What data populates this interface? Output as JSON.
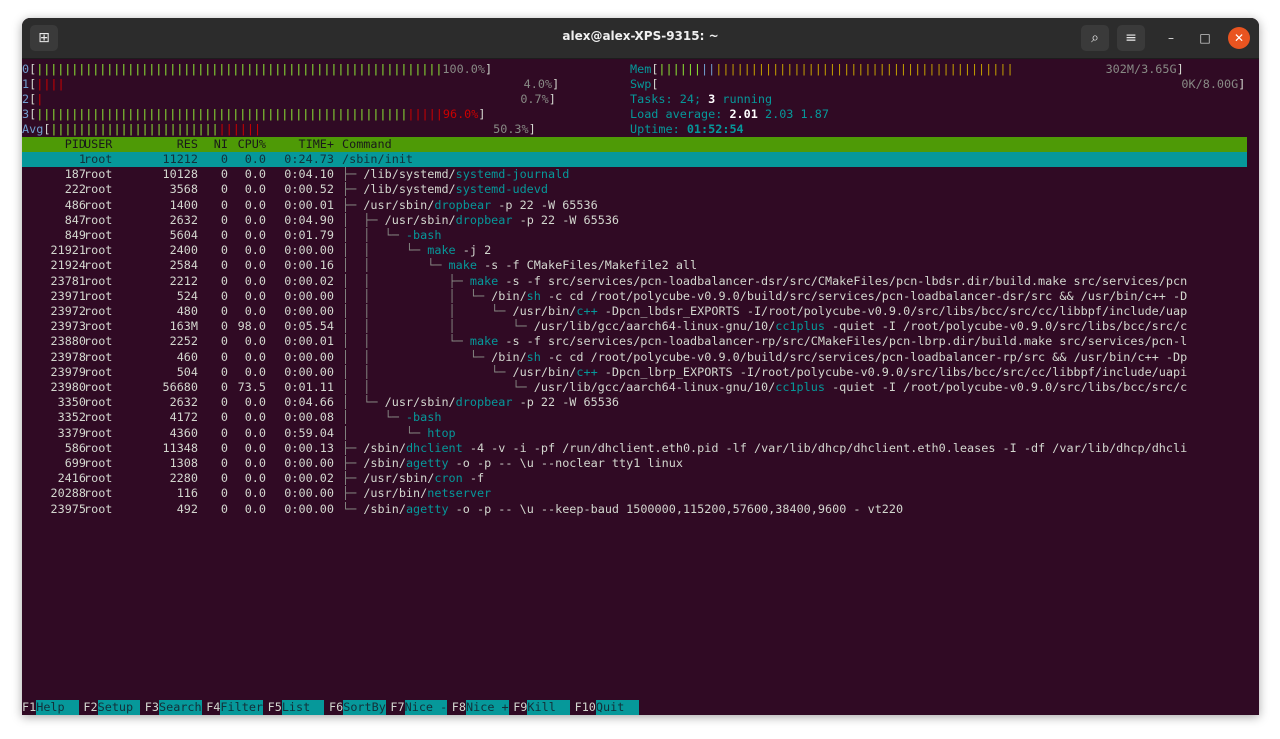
{
  "window": {
    "title": "alex@alex-XPS-9315: ~",
    "icons": {
      "new_tab": "new-tab-icon",
      "search": "search-icon",
      "menu": "hamburger-menu-icon",
      "min": "minimize-icon",
      "max": "maximize-icon",
      "close": "close-icon"
    }
  },
  "meters": {
    "cpu": [
      {
        "label": "0",
        "percent": "100.0%"
      },
      {
        "label": "1",
        "percent": "4.0%"
      },
      {
        "label": "2",
        "percent": "0.7%"
      },
      {
        "label": "3",
        "percent": "96.0%"
      },
      {
        "label": "Avg",
        "percent": "50.3%"
      }
    ],
    "mem": {
      "label": "Mem",
      "value": "302M/3.65G"
    },
    "swp": {
      "label": "Swp",
      "value": "0K/8.00G"
    },
    "tasks": {
      "label": "Tasks:",
      "count": "24;",
      "running": "3",
      "running_label": "running"
    },
    "load": {
      "label": "Load average:",
      "l1": "2.01",
      "l5": "2.03",
      "l15": "1.87"
    },
    "uptime": {
      "label": "Uptime:",
      "value": "01:52:54"
    }
  },
  "columns": [
    "PID",
    "USER",
    "RES",
    "NI",
    "CPU%",
    "TIME+",
    "Command"
  ],
  "processes": [
    {
      "pid": "1",
      "user": "root",
      "res": "11212",
      "ni": "0",
      "cpu": "0.0",
      "time": "0:24.73",
      "tree": "",
      "pre": "/sbin/",
      "hl": "init",
      "rest": ""
    },
    {
      "pid": "187",
      "user": "root",
      "res": "10128",
      "ni": "0",
      "cpu": "0.0",
      "time": "0:04.10",
      "tree": "├─ ",
      "pre": "/lib/systemd/",
      "hl": "systemd-journald",
      "rest": ""
    },
    {
      "pid": "222",
      "user": "root",
      "res": "3568",
      "ni": "0",
      "cpu": "0.0",
      "time": "0:00.52",
      "tree": "├─ ",
      "pre": "/lib/systemd/",
      "hl": "systemd-udevd",
      "rest": ""
    },
    {
      "pid": "486",
      "user": "root",
      "res": "1400",
      "ni": "0",
      "cpu": "0.0",
      "time": "0:00.01",
      "tree": "├─ ",
      "pre": "/usr/sbin/",
      "hl": "dropbear",
      "rest": " -p 22 -W 65536"
    },
    {
      "pid": "847",
      "user": "root",
      "res": "2632",
      "ni": "0",
      "cpu": "0.0",
      "time": "0:04.90",
      "tree": "│  ├─ ",
      "pre": "/usr/sbin/",
      "hl": "dropbear",
      "rest": " -p 22 -W 65536"
    },
    {
      "pid": "849",
      "user": "root",
      "res": "5604",
      "ni": "0",
      "cpu": "0.0",
      "time": "0:01.79",
      "tree": "│  │  └─ ",
      "pre": "",
      "hl": "-bash",
      "rest": ""
    },
    {
      "pid": "21921",
      "user": "root",
      "res": "2400",
      "ni": "0",
      "cpu": "0.0",
      "time": "0:00.00",
      "tree": "│  │     └─ ",
      "pre": "",
      "hl": "make",
      "rest": " -j 2"
    },
    {
      "pid": "21924",
      "user": "root",
      "res": "2584",
      "ni": "0",
      "cpu": "0.0",
      "time": "0:00.16",
      "tree": "│  │        └─ ",
      "pre": "",
      "hl": "make",
      "rest": " -s -f CMakeFiles/Makefile2 all"
    },
    {
      "pid": "23781",
      "user": "root",
      "res": "2212",
      "ni": "0",
      "cpu": "0.0",
      "time": "0:00.02",
      "tree": "│  │           ├─ ",
      "pre": "",
      "hl": "make",
      "rest": " -s -f src/services/pcn-loadbalancer-dsr/src/CMakeFiles/pcn-lbdsr.dir/build.make src/services/pcn"
    },
    {
      "pid": "23971",
      "user": "root",
      "res": "524",
      "ni": "0",
      "cpu": "0.0",
      "time": "0:00.00",
      "tree": "│  │           │  └─ ",
      "pre": "/bin/",
      "hl": "sh",
      "rest": " -c cd /root/polycube-v0.9.0/build/src/services/pcn-loadbalancer-dsr/src && /usr/bin/c++ -D"
    },
    {
      "pid": "23972",
      "user": "root",
      "res": "480",
      "ni": "0",
      "cpu": "0.0",
      "time": "0:00.00",
      "tree": "│  │           │     └─ ",
      "pre": "/usr/bin/",
      "hl": "c++",
      "rest": " -Dpcn_lbdsr_EXPORTS -I/root/polycube-v0.9.0/src/libs/bcc/src/cc/libbpf/include/uap"
    },
    {
      "pid": "23973",
      "user": "root",
      "res": "163M",
      "ni": "0",
      "cpu": "98.0",
      "time": "0:05.54",
      "tree": "│  │           │        └─ ",
      "pre": "/usr/lib/gcc/aarch64-linux-gnu/10/",
      "hl": "cc1plus",
      "rest": " -quiet -I /root/polycube-v0.9.0/src/libs/bcc/src/c"
    },
    {
      "pid": "23880",
      "user": "root",
      "res": "2252",
      "ni": "0",
      "cpu": "0.0",
      "time": "0:00.01",
      "tree": "│  │           └─ ",
      "pre": "",
      "hl": "make",
      "rest": " -s -f src/services/pcn-loadbalancer-rp/src/CMakeFiles/pcn-lbrp.dir/build.make src/services/pcn-l"
    },
    {
      "pid": "23978",
      "user": "root",
      "res": "460",
      "ni": "0",
      "cpu": "0.0",
      "time": "0:00.00",
      "tree": "│  │              └─ ",
      "pre": "/bin/",
      "hl": "sh",
      "rest": " -c cd /root/polycube-v0.9.0/build/src/services/pcn-loadbalancer-rp/src && /usr/bin/c++ -Dp"
    },
    {
      "pid": "23979",
      "user": "root",
      "res": "504",
      "ni": "0",
      "cpu": "0.0",
      "time": "0:00.00",
      "tree": "│  │                 └─ ",
      "pre": "/usr/bin/",
      "hl": "c++",
      "rest": " -Dpcn_lbrp_EXPORTS -I/root/polycube-v0.9.0/src/libs/bcc/src/cc/libbpf/include/uapi"
    },
    {
      "pid": "23980",
      "user": "root",
      "res": "56680",
      "ni": "0",
      "cpu": "73.5",
      "time": "0:01.11",
      "tree": "│  │                    └─ ",
      "pre": "/usr/lib/gcc/aarch64-linux-gnu/10/",
      "hl": "cc1plus",
      "rest": " -quiet -I /root/polycube-v0.9.0/src/libs/bcc/src/c"
    },
    {
      "pid": "3350",
      "user": "root",
      "res": "2632",
      "ni": "0",
      "cpu": "0.0",
      "time": "0:04.66",
      "tree": "│  └─ ",
      "pre": "/usr/sbin/",
      "hl": "dropbear",
      "rest": " -p 22 -W 65536"
    },
    {
      "pid": "3352",
      "user": "root",
      "res": "4172",
      "ni": "0",
      "cpu": "0.0",
      "time": "0:00.08",
      "tree": "│     └─ ",
      "pre": "",
      "hl": "-bash",
      "rest": ""
    },
    {
      "pid": "3379",
      "user": "root",
      "res": "4360",
      "ni": "0",
      "cpu": "0.0",
      "time": "0:59.04",
      "tree": "│        └─ ",
      "pre": "",
      "hl": "htop",
      "rest": ""
    },
    {
      "pid": "586",
      "user": "root",
      "res": "11348",
      "ni": "0",
      "cpu": "0.0",
      "time": "0:00.13",
      "tree": "├─ ",
      "pre": "/sbin/",
      "hl": "dhclient",
      "rest": " -4 -v -i -pf /run/dhclient.eth0.pid -lf /var/lib/dhcp/dhclient.eth0.leases -I -df /var/lib/dhcp/dhcli"
    },
    {
      "pid": "699",
      "user": "root",
      "res": "1308",
      "ni": "0",
      "cpu": "0.0",
      "time": "0:00.00",
      "tree": "├─ ",
      "pre": "/sbin/",
      "hl": "agetty",
      "rest": " -o -p -- \\u --noclear tty1 linux"
    },
    {
      "pid": "2416",
      "user": "root",
      "res": "2280",
      "ni": "0",
      "cpu": "0.0",
      "time": "0:00.02",
      "tree": "├─ ",
      "pre": "/usr/sbin/",
      "hl": "cron",
      "rest": " -f"
    },
    {
      "pid": "20288",
      "user": "root",
      "res": "116",
      "ni": "0",
      "cpu": "0.0",
      "time": "0:00.00",
      "tree": "├─ ",
      "pre": "/usr/bin/",
      "hl": "netserver",
      "rest": ""
    },
    {
      "pid": "23975",
      "user": "root",
      "res": "492",
      "ni": "0",
      "cpu": "0.0",
      "time": "0:00.00",
      "tree": "└─ ",
      "pre": "/sbin/",
      "hl": "agetty",
      "rest": " -o -p -- \\u --keep-baud 1500000,115200,57600,38400,9600 - vt220"
    }
  ],
  "fkeys": [
    {
      "key": "F1",
      "label": "Help  "
    },
    {
      "key": "F2",
      "label": "Setup "
    },
    {
      "key": "F3",
      "label": "Search"
    },
    {
      "key": "F4",
      "label": "Filter"
    },
    {
      "key": "F5",
      "label": "List  "
    },
    {
      "key": "F6",
      "label": "SortBy"
    },
    {
      "key": "F7",
      "label": "Nice -"
    },
    {
      "key": "F8",
      "label": "Nice +"
    },
    {
      "key": "F9",
      "label": "Kill  "
    },
    {
      "key": "F10",
      "label": "Quit  "
    }
  ],
  "colors": {
    "terminal_bg": "#300a24",
    "header_green": "#4e9a06",
    "selected_cyan": "#06989a"
  }
}
